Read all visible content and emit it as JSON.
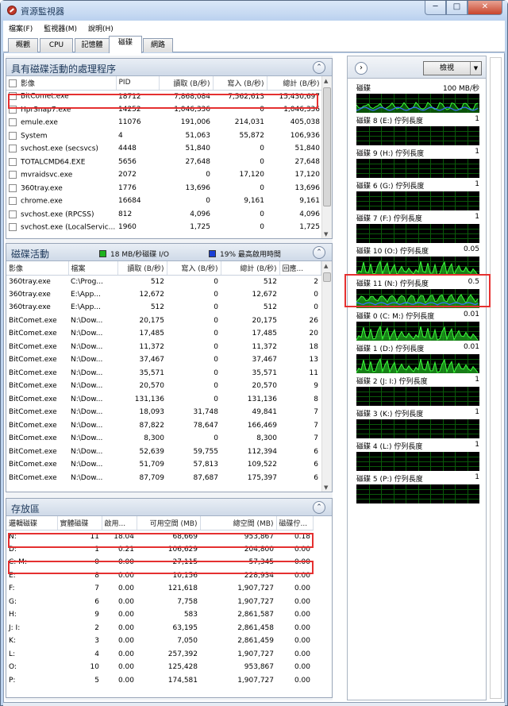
{
  "window": {
    "title": "資源監視器",
    "buttons": [
      "─",
      "□",
      "✕"
    ]
  },
  "menu": [
    "檔案(F)",
    "監視器(M)",
    "說明(H)"
  ],
  "tabs": [
    "概觀",
    "CPU",
    "記憶體",
    "磁碟",
    "網路"
  ],
  "active_tab": "磁碟",
  "processes": {
    "title": "具有磁碟活動的處理程序",
    "columns": [
      "影像",
      "PID",
      "讀取 (B/秒)",
      "寫入 (B/秒)",
      "總計 (B/秒)"
    ],
    "rows": [
      [
        "BitComet.exe",
        "18712",
        "7,868,084",
        "7,562,613",
        "15,430,697"
      ],
      [
        "HprSnap7.exe",
        "14252",
        "1,046,336",
        "0",
        "1,046,336"
      ],
      [
        "emule.exe",
        "11076",
        "191,006",
        "214,031",
        "405,038"
      ],
      [
        "System",
        "4",
        "51,063",
        "55,872",
        "106,936"
      ],
      [
        "svchost.exe (secsvcs)",
        "4448",
        "51,840",
        "0",
        "51,840"
      ],
      [
        "TOTALCMD64.EXE",
        "5656",
        "27,648",
        "0",
        "27,648"
      ],
      [
        "mvraidsvc.exe",
        "2072",
        "0",
        "17,120",
        "17,120"
      ],
      [
        "360tray.exe",
        "1776",
        "13,696",
        "0",
        "13,696"
      ],
      [
        "chrome.exe",
        "16684",
        "0",
        "9,161",
        "9,161"
      ],
      [
        "svchost.exe (RPCSS)",
        "812",
        "4,096",
        "0",
        "4,096"
      ],
      [
        "svchost.exe (LocalServic...",
        "1960",
        "1,725",
        "0",
        "1,725"
      ]
    ]
  },
  "disk_activity": {
    "title": "磁碟活動",
    "legend_io": "18 MB/秒磁碟 I/O",
    "legend_active": "19% 最高啟用時間",
    "columns": [
      "影像",
      "檔案",
      "讀取 (B/秒)",
      "寫入 (B/秒)",
      "總計 (B/秒)",
      "回應..."
    ],
    "rows": [
      [
        "360tray.exe",
        "C:\\Prog...",
        "512",
        "0",
        "512",
        "2"
      ],
      [
        "360tray.exe",
        "E:\\App...",
        "12,672",
        "0",
        "12,672",
        "0"
      ],
      [
        "360tray.exe",
        "E:\\App...",
        "512",
        "0",
        "512",
        "0"
      ],
      [
        "BitComet.exe",
        "N:\\Dow...",
        "20,175",
        "0",
        "20,175",
        "26"
      ],
      [
        "BitComet.exe",
        "N:\\Dow...",
        "17,485",
        "0",
        "17,485",
        "20"
      ],
      [
        "BitComet.exe",
        "N:\\Dow...",
        "11,372",
        "0",
        "11,372",
        "18"
      ],
      [
        "BitComet.exe",
        "N:\\Dow...",
        "37,467",
        "0",
        "37,467",
        "13"
      ],
      [
        "BitComet.exe",
        "N:\\Dow...",
        "35,571",
        "0",
        "35,571",
        "11"
      ],
      [
        "BitComet.exe",
        "N:\\Dow...",
        "20,570",
        "0",
        "20,570",
        "9"
      ],
      [
        "BitComet.exe",
        "N:\\Dow...",
        "131,136",
        "0",
        "131,136",
        "8"
      ],
      [
        "BitComet.exe",
        "N:\\Dow...",
        "18,093",
        "31,748",
        "49,841",
        "7"
      ],
      [
        "BitComet.exe",
        "N:\\Dow...",
        "87,822",
        "78,647",
        "166,469",
        "7"
      ],
      [
        "BitComet.exe",
        "N:\\Dow...",
        "8,300",
        "0",
        "8,300",
        "7"
      ],
      [
        "BitComet.exe",
        "N:\\Dow...",
        "52,639",
        "59,755",
        "112,394",
        "6"
      ],
      [
        "BitComet.exe",
        "N:\\Dow...",
        "51,709",
        "57,813",
        "109,522",
        "6"
      ],
      [
        "BitComet.exe",
        "N:\\Dow...",
        "87,709",
        "87,687",
        "175,397",
        "6"
      ]
    ]
  },
  "storage": {
    "title": "存放區",
    "columns": [
      "邏輯磁碟",
      "實體磁碟",
      "啟用...",
      "可用空間 (MB)",
      "總空間 (MB)",
      "磁碟佇..."
    ],
    "rows": [
      [
        "N:",
        "11",
        "18.04",
        "68,669",
        "953,867",
        "0.18"
      ],
      [
        "D:",
        "1",
        "0.21",
        "106,629",
        "204,800",
        "0.00"
      ],
      [
        "C: M:",
        "0",
        "0.00",
        "27,115",
        "57,345",
        "0.00"
      ],
      [
        "E:",
        "8",
        "0.00",
        "10,156",
        "228,934",
        "0.00"
      ],
      [
        "F:",
        "7",
        "0.00",
        "121,618",
        "1,907,727",
        "0.00"
      ],
      [
        "G:",
        "6",
        "0.00",
        "7,758",
        "1,907,727",
        "0.00"
      ],
      [
        "H:",
        "9",
        "0.00",
        "583",
        "2,861,587",
        "0.00"
      ],
      [
        "J: I:",
        "2",
        "0.00",
        "63,195",
        "2,861,458",
        "0.00"
      ],
      [
        "K:",
        "3",
        "0.00",
        "7,050",
        "2,861,459",
        "0.00"
      ],
      [
        "L:",
        "4",
        "0.00",
        "257,392",
        "1,907,727",
        "0.00"
      ],
      [
        "O:",
        "10",
        "0.00",
        "125,428",
        "953,867",
        "0.00"
      ],
      [
        "P:",
        "5",
        "0.00",
        "174,581",
        "1,907,727",
        "0.00"
      ]
    ]
  },
  "graphs": {
    "view_label": "檢視",
    "items": [
      {
        "label": "磁碟",
        "value": "100 MB/秒"
      },
      {
        "label": "磁碟 8 (E:) 佇列長度",
        "value": "1"
      },
      {
        "label": "磁碟 9 (H:) 佇列長度",
        "value": "1"
      },
      {
        "label": "磁碟 6 (G:) 佇列長度",
        "value": "1"
      },
      {
        "label": "磁碟 7 (F:) 佇列長度",
        "value": "1"
      },
      {
        "label": "磁碟 10 (O:) 佇列長度",
        "value": "0.05"
      },
      {
        "label": "磁碟 11 (N:) 佇列長度",
        "value": "0.5"
      },
      {
        "label": "磁碟 0 (C: M:) 佇列長度",
        "value": "0.01"
      },
      {
        "label": "磁碟 1 (D:) 佇列長度",
        "value": "0.01"
      },
      {
        "label": "磁碟 2 (J: I:) 佇列長度",
        "value": "1"
      },
      {
        "label": "磁碟 3 (K:) 佇列長度",
        "value": "1"
      },
      {
        "label": "磁碟 4 (L:) 佇列長度",
        "value": "1"
      },
      {
        "label": "磁碟 5 (P:) 佇列長度",
        "value": "1"
      }
    ]
  },
  "colors": {
    "io_green": "#1db31d",
    "active_blue": "#1a3fd6",
    "highlight": "#e53030"
  }
}
